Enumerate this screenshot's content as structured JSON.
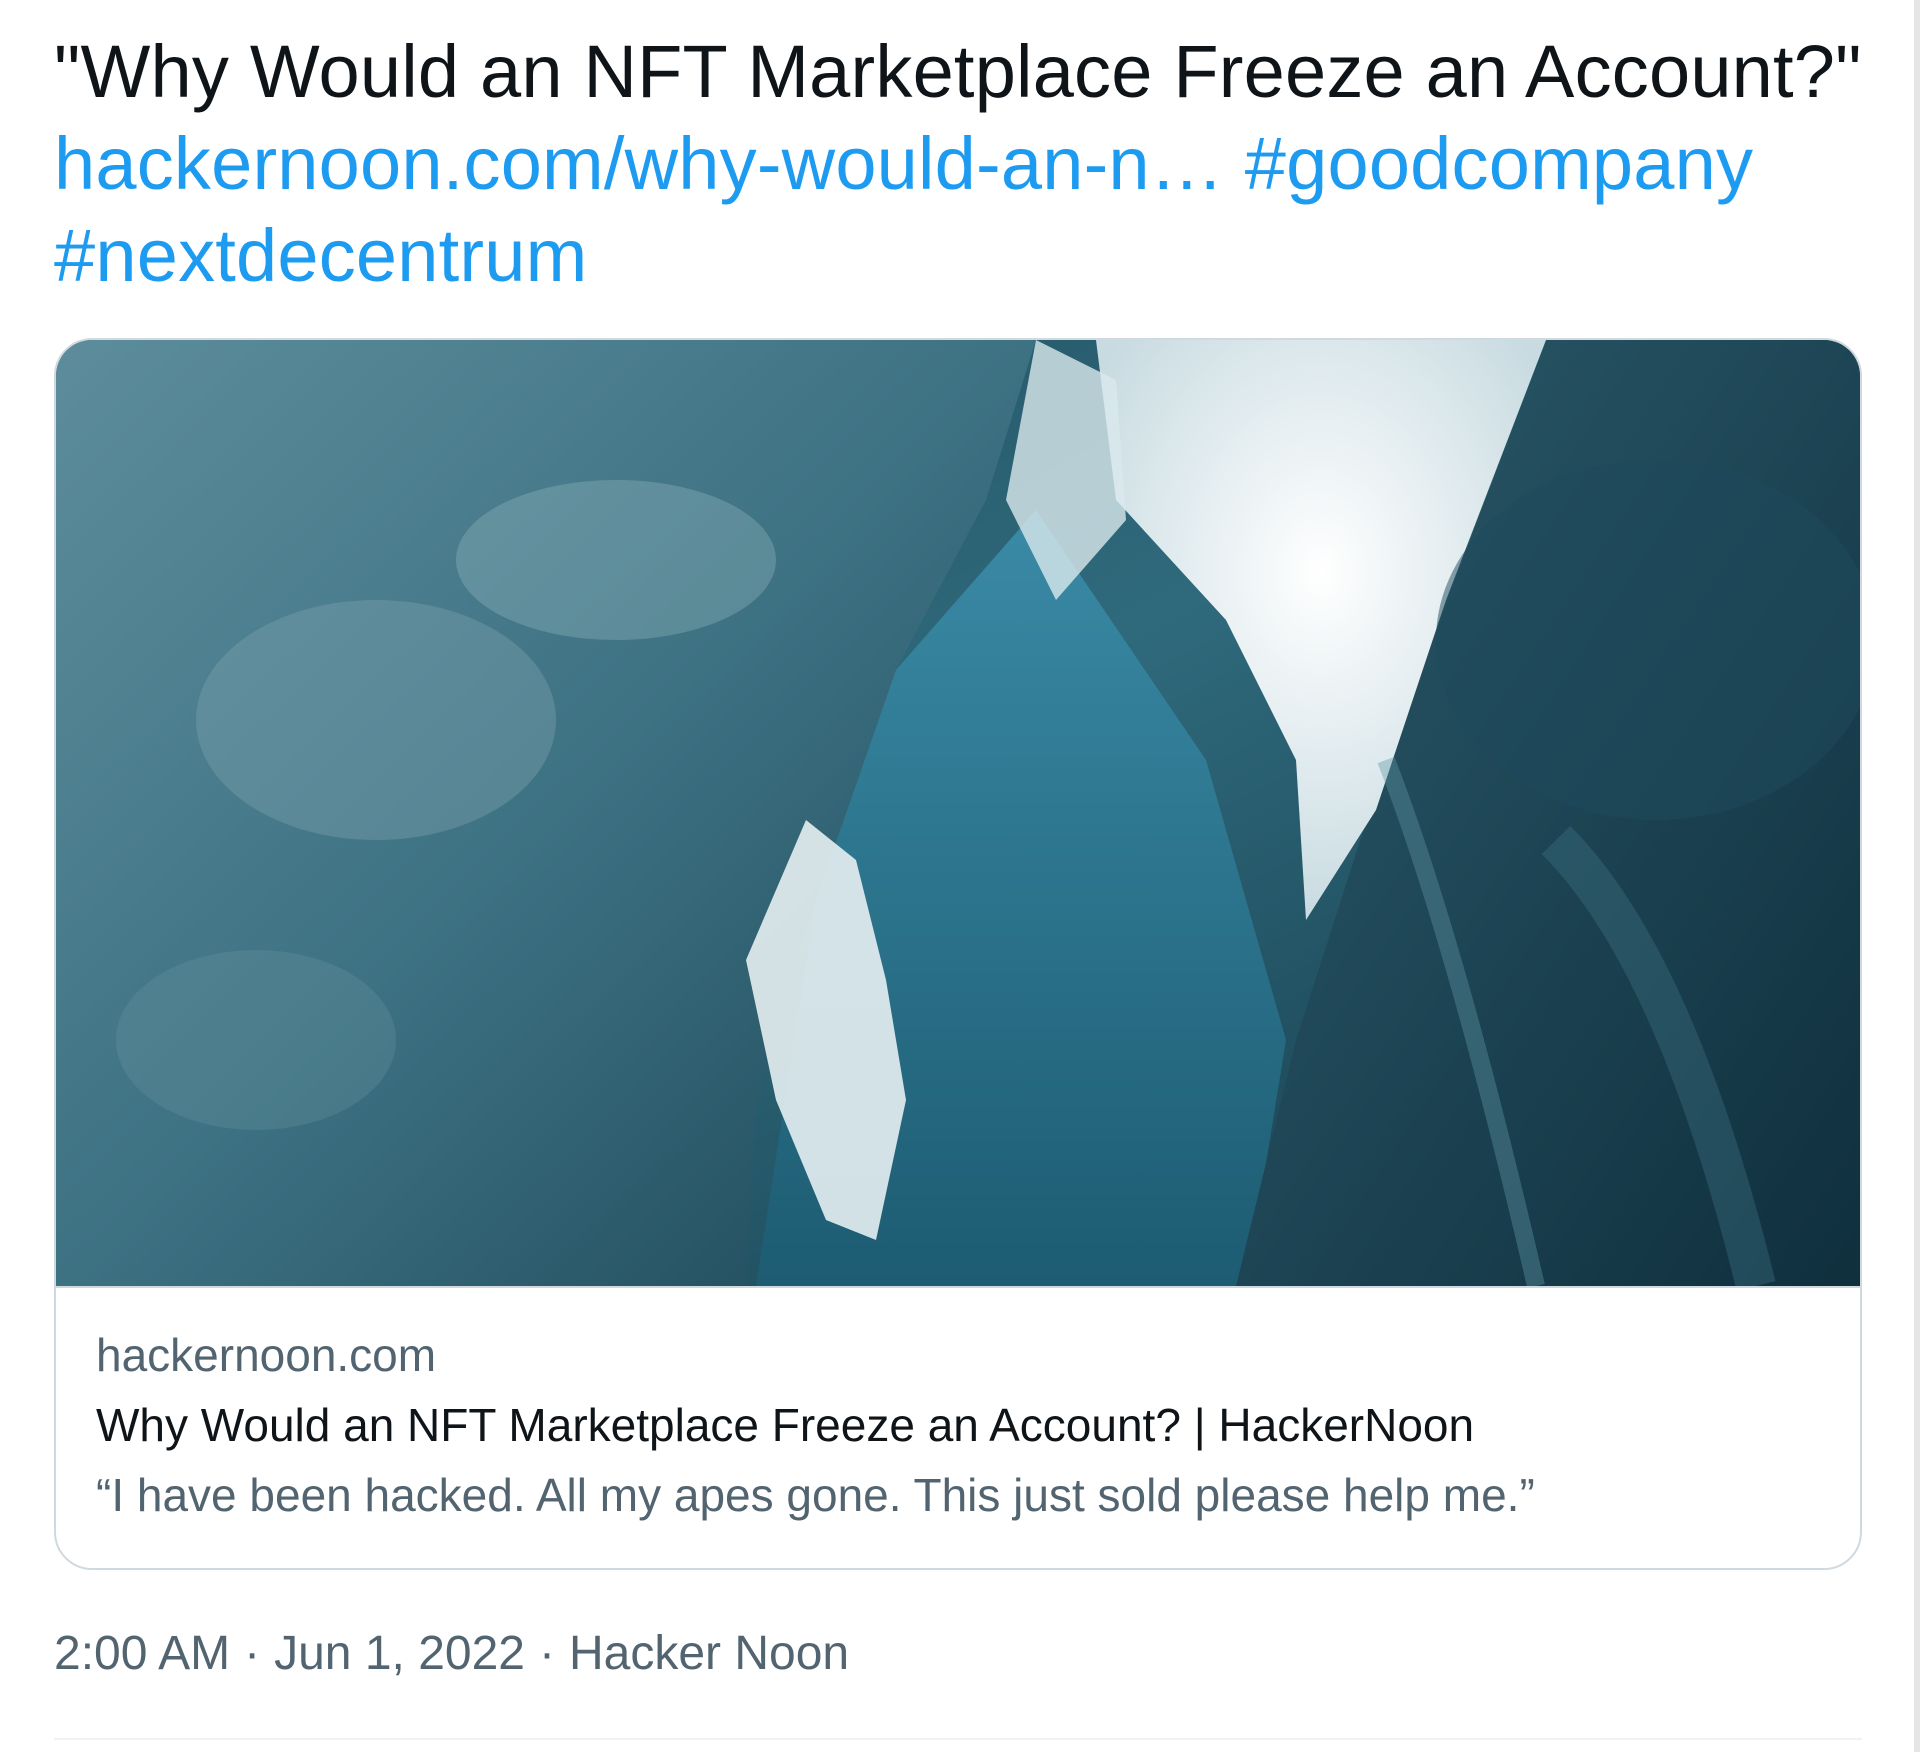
{
  "tweet": {
    "text_line1": "\"Why Would an NFT Marketplace Freeze an Account?\"",
    "link_text": "hackernoon.com/why-would-an-n…",
    "hashtag1": "#goodcompany",
    "hashtag2": "#nextdecentrum"
  },
  "card": {
    "image_alt": "Ice cave photo",
    "domain": "hackernoon.com",
    "title": "Why Would an NFT Marketplace Freeze an Account? | HackerNoon",
    "description": "“I have been hacked. All my apes gone. This just sold please help me.”"
  },
  "meta": {
    "time": "2:00 AM",
    "separator": "·",
    "date": "Jun 1, 2022",
    "source": "Hacker Noon"
  },
  "colors": {
    "link": "#1d9bf0",
    "text": "#0f1419",
    "secondary": "#536471",
    "border": "#cfd9de"
  }
}
